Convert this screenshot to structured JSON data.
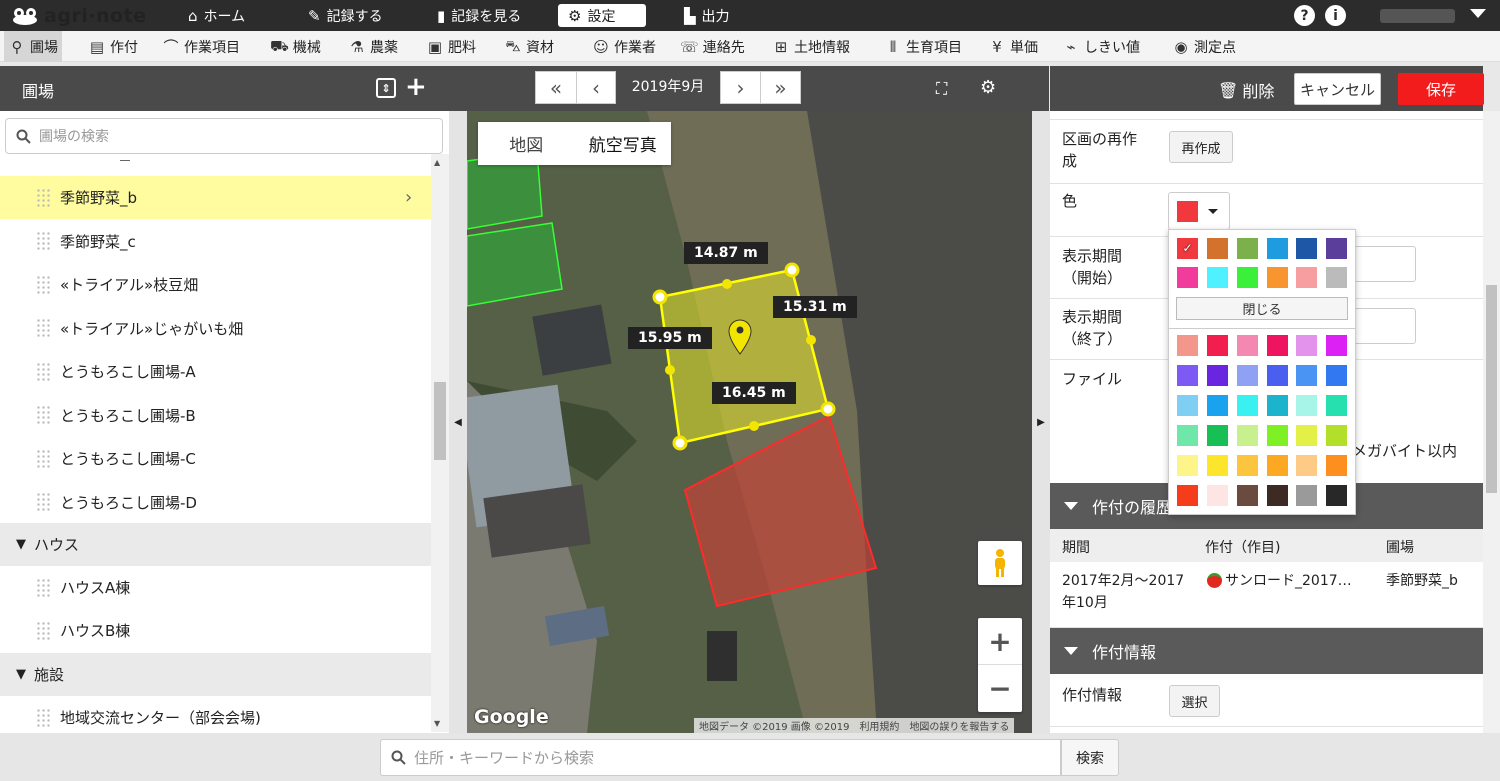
{
  "app": {
    "logo": "agri·note"
  },
  "topnav": [
    {
      "label": "ホーム",
      "icon": "home-icon"
    },
    {
      "label": "記録する",
      "icon": "pencil-icon"
    },
    {
      "label": "記録を見る",
      "icon": "book-icon"
    },
    {
      "label": "設定",
      "icon": "gear-icon",
      "active": true
    },
    {
      "label": "出力",
      "icon": "file-icon"
    }
  ],
  "subnav": [
    {
      "label": "圃場",
      "icon": "map-pin-icon",
      "active": true
    },
    {
      "label": "作付",
      "icon": "document-icon"
    },
    {
      "label": "作業項目",
      "icon": "sickle-icon"
    },
    {
      "label": "機械",
      "icon": "tractor-icon"
    },
    {
      "label": "農薬",
      "icon": "flask-icon"
    },
    {
      "label": "肥料",
      "icon": "fertilizer-bag-icon"
    },
    {
      "label": "資材",
      "icon": "wheelbarrow-icon"
    },
    {
      "label": "作業者",
      "icon": "person-icon"
    },
    {
      "label": "連絡先",
      "icon": "phone-book-icon"
    },
    {
      "label": "土地情報",
      "icon": "land-icon"
    },
    {
      "label": "生育項目",
      "icon": "growth-icon"
    },
    {
      "label": "単価",
      "icon": "yen-icon"
    },
    {
      "label": "しきい値",
      "icon": "threshold-chart-icon"
    },
    {
      "label": "測定点",
      "icon": "measure-point-icon"
    }
  ],
  "left": {
    "title": "圃場",
    "search_placeholder": "圃場の検索",
    "items": [
      {
        "label": "季節野菜_b",
        "selected": true
      },
      {
        "label": "季節野菜_c"
      },
      {
        "label": "«トライアル»枝豆畑"
      },
      {
        "label": "«トライアル»じゃがいも畑"
      },
      {
        "label": "とうもろこし圃場-A"
      },
      {
        "label": "とうもろこし圃場-B"
      },
      {
        "label": "とうもろこし圃場-C"
      },
      {
        "label": "とうもろこし圃場-D"
      }
    ],
    "group_house": "ハウス",
    "house_items": [
      "ハウスA棟",
      "ハウスB棟"
    ],
    "group_facility": "施設",
    "facility_items": [
      "地域交流センター（部会会場)"
    ]
  },
  "map": {
    "date": "2019年9月",
    "type_map": "地図",
    "type_aerial": "航空写真",
    "measures": [
      "14.87 m",
      "15.31 m",
      "15.95 m",
      "16.45 m"
    ],
    "google": "Google",
    "attrib": [
      "地図データ ©2019 画像 ©2019",
      "利用規約",
      "地図の誤りを報告する"
    ],
    "zoom_in": "+",
    "zoom_out": "−"
  },
  "right": {
    "delete": "削除",
    "cancel": "キャンセル",
    "save": "保存",
    "remake_label_1": "区画の再作",
    "remake_label_2": "成",
    "remake_btn": "再作成",
    "color_label": "色",
    "selected_color": "#f0383e",
    "start_label_1": "表示期間",
    "start_label_2": "（開始）",
    "end_label_1": "表示期間",
    "end_label_2": "（終了）",
    "file_label": "ファイル",
    "file_note": "メガバイト以内",
    "history_title": "作付の履歴",
    "hist_cols": [
      "期間",
      "作付（作目)",
      "圃場"
    ],
    "hist_period": "2017年2月〜2017",
    "hist_period2": "年10月",
    "hist_crop": "サンロード_2017…",
    "hist_field": "季節野菜_b",
    "info_title": "作付情報",
    "info_label": "作付情報",
    "info_btn": "選択"
  },
  "picker": {
    "close": "閉じる",
    "row1": [
      "#f0383e",
      "#d2722c",
      "#7bb04b",
      "#1f9be0",
      "#1d57a5",
      "#5b3d9c"
    ],
    "row2": [
      "#f23c9c",
      "#4ff0ff",
      "#3af03a",
      "#f8952e",
      "#f79ea0",
      "#bbbbbb"
    ],
    "palette": [
      [
        "#f3978d",
        "#f21e4e",
        "#f388b0",
        "#ee1460",
        "#e493ed",
        "#db21f3"
      ],
      [
        "#7e5af5",
        "#6a25e1",
        "#8ea1f3",
        "#4a5ef0",
        "#4a94f3",
        "#3278f0"
      ],
      [
        "#7fcff5",
        "#19a3ee",
        "#3af0f0",
        "#1cb4cc",
        "#a7f5e8",
        "#26e0b0"
      ],
      [
        "#6fe7a9",
        "#17bf55",
        "#c9f08e",
        "#7ff024",
        "#e2f048",
        "#b2e02a"
      ],
      [
        "#fdf48a",
        "#fde52d",
        "#fdc440",
        "#fda823",
        "#fdcb86",
        "#fd8f1f"
      ],
      [
        "#f53d1c",
        "#fde5e3",
        "#6b4b40",
        "#3d2a24",
        "#9a9a9a",
        "#282828"
      ]
    ]
  },
  "bottom": {
    "search_placeholder": "住所・キーワードから検索",
    "search_btn": "検索"
  }
}
